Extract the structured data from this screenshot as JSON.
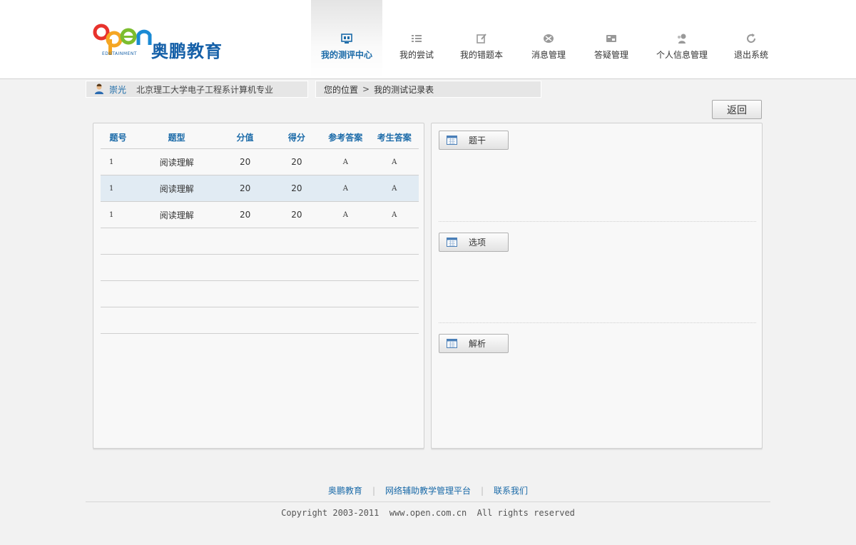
{
  "brand": {
    "name": "奥鹏教育",
    "logo_word": "open",
    "logo_sub": "EDUTAINMENT",
    "colors": {
      "primary": "#1560a8",
      "red": "#e8322c",
      "orange": "#f5a623",
      "green": "#7cbd2e",
      "blue": "#1a8ad4"
    }
  },
  "nav": [
    {
      "label": "我的测评中心",
      "icon": "assessment-icon",
      "active": true
    },
    {
      "label": "我的尝试",
      "icon": "list-icon",
      "active": false
    },
    {
      "label": "我的错题本",
      "icon": "edit-icon",
      "active": false
    },
    {
      "label": "消息管理",
      "icon": "message-icon",
      "active": false
    },
    {
      "label": "答疑管理",
      "icon": "qa-icon",
      "active": false
    },
    {
      "label": "个人信息管理",
      "icon": "user-icon",
      "active": false
    },
    {
      "label": "退出系统",
      "icon": "refresh-icon",
      "active": false
    }
  ],
  "user": {
    "name": "崇光",
    "dept": "北京理工大学电子工程系计算机专业"
  },
  "breadcrumb": {
    "prefix": "您的位置",
    "current": "我的测试记录表"
  },
  "back_label": "返回",
  "table": {
    "headers": [
      "题号",
      "题型",
      "分值",
      "得分",
      "参考答案",
      "考生答案"
    ],
    "rows": [
      [
        "1",
        "阅读理解",
        "20",
        "20",
        "A",
        "A"
      ],
      [
        "1",
        "阅读理解",
        "20",
        "20",
        "A",
        "A"
      ],
      [
        "1",
        "阅读理解",
        "20",
        "20",
        "A",
        "A"
      ]
    ],
    "highlight_row": 1
  },
  "sections": [
    "题干",
    "选项",
    "解析"
  ],
  "footer": {
    "links": [
      "奥鹏教育",
      "网络辅助教学管理平台",
      "联系我们"
    ],
    "separator": "|",
    "copyright": "Copyright 2003-2011  www.open.com.cn  All rights reserved"
  }
}
